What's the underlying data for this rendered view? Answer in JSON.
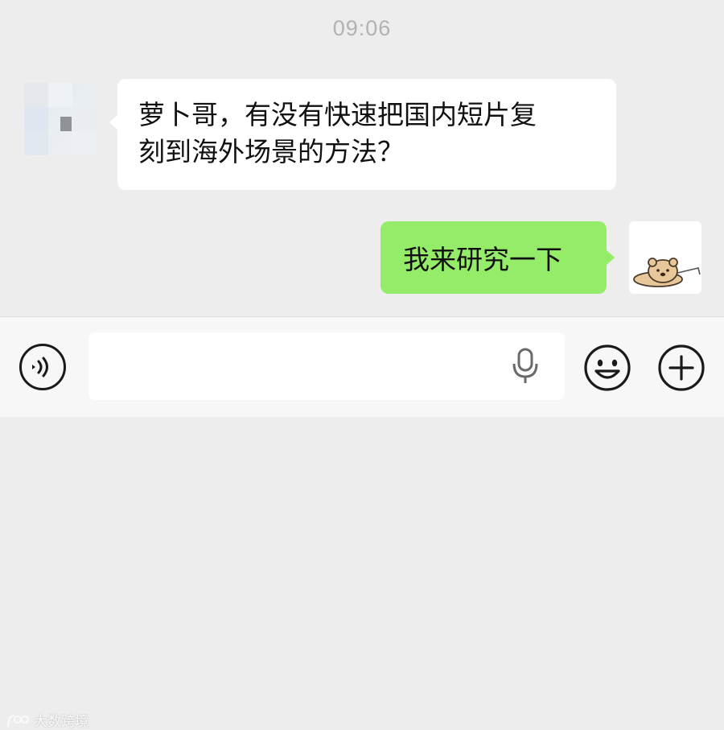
{
  "chat": {
    "timestamp": "09:06",
    "messages": [
      {
        "side": "left",
        "lines": [
          "萝卜哥，有没有快速把国内短片复",
          "刻到海外场景的方法？"
        ]
      },
      {
        "side": "right",
        "text": "我来研究一下"
      }
    ]
  },
  "input_bar": {
    "text_value": "",
    "icons": {
      "voice": "voice-icon",
      "mic": "microphone-icon",
      "emoji": "emoji-icon",
      "plus": "plus-icon"
    }
  },
  "watermark": {
    "text": "大数跨境"
  },
  "colors": {
    "background": "#ededed",
    "bubble_incoming": "#ffffff",
    "bubble_outgoing": "#95ec69",
    "timestamp": "#b2b2b2"
  }
}
